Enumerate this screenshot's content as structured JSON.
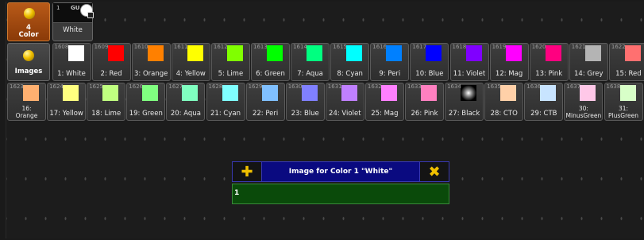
{
  "header": {
    "color_button": {
      "line1": "4",
      "line2": "Color"
    },
    "white_preset": {
      "number": "1",
      "code": "GU",
      "label": "White"
    },
    "images_button": {
      "label": "Images"
    }
  },
  "images_row1": [
    {
      "num": "1608",
      "label": "1: White",
      "color": "#ffffff"
    },
    {
      "num": "1609",
      "label": "2: Red",
      "color": "#ff0000"
    },
    {
      "num": "1610",
      "label": "3: Orange",
      "color": "#ff8000"
    },
    {
      "num": "1611",
      "label": "4: Yellow",
      "color": "#ffff00"
    },
    {
      "num": "1612",
      "label": "5: Lime",
      "color": "#80ff00"
    },
    {
      "num": "1613",
      "label": "6: Green",
      "color": "#00ff00"
    },
    {
      "num": "1614",
      "label": "7: Aqua",
      "color": "#00ff80"
    },
    {
      "num": "1615",
      "label": "8: Cyan",
      "color": "#00ffff"
    },
    {
      "num": "1616",
      "label": "9: Peri",
      "color": "#0080ff"
    },
    {
      "num": "1617",
      "label": "10: Blue",
      "color": "#0000ff"
    },
    {
      "num": "1618",
      "label": "11: Violet",
      "color": "#8000ff"
    },
    {
      "num": "1619",
      "label": "12: Mag",
      "color": "#ff00ff"
    },
    {
      "num": "1620",
      "label": "13: Pink",
      "color": "#ff0080"
    },
    {
      "num": "1621",
      "label": "14: Grey",
      "color": "#b4b4b4"
    },
    {
      "num": "1622",
      "label": "15: Red",
      "color": "#ff7070"
    }
  ],
  "images_row2": [
    {
      "num": "1623",
      "label": "16: Orange",
      "color": "#ffb070",
      "two_line": true
    },
    {
      "num": "1624",
      "label": "17: Yellow",
      "color": "#ffff80"
    },
    {
      "num": "1625",
      "label": "18: Lime",
      "color": "#c0ff80"
    },
    {
      "num": "1626",
      "label": "19: Green",
      "color": "#80ff80"
    },
    {
      "num": "1627",
      "label": "20: Aqua",
      "color": "#80ffc0"
    },
    {
      "num": "1628",
      "label": "21: Cyan",
      "color": "#80ffff"
    },
    {
      "num": "1629",
      "label": "22: Peri",
      "color": "#80c0ff"
    },
    {
      "num": "1630",
      "label": "23: Blue",
      "color": "#8080ff"
    },
    {
      "num": "1631",
      "label": "24: Violet",
      "color": "#c080ff"
    },
    {
      "num": "1632",
      "label": "25: Mag",
      "color": "#ff80ff"
    },
    {
      "num": "1633",
      "label": "26: Pink",
      "color": "#ff80c0"
    },
    {
      "num": "1634",
      "label": "27: Black",
      "color": "#000000",
      "glow": true
    },
    {
      "num": "1635",
      "label": "28: CTO",
      "color": "#ffd0a8"
    },
    {
      "num": "1636",
      "label": "29: CTB",
      "color": "#c8e4ff"
    },
    {
      "num": "1637",
      "label": "30: MinusGreen",
      "color": "#ffc8e8",
      "two_line": true
    },
    {
      "num": "1638",
      "label": "31: PlusGreen",
      "color": "#d8ffc8",
      "two_line": true
    }
  ],
  "dialog": {
    "add_icon": "plus-icon",
    "title": "Image for Color 1 \"White\"",
    "close_icon": "close-icon",
    "input_value": "1"
  },
  "colors": {
    "accent_orange": "#b85a18",
    "dialog_header": "#0a0a80",
    "dialog_input": "#0a4a0a",
    "icon_yellow": "#f0c000"
  }
}
